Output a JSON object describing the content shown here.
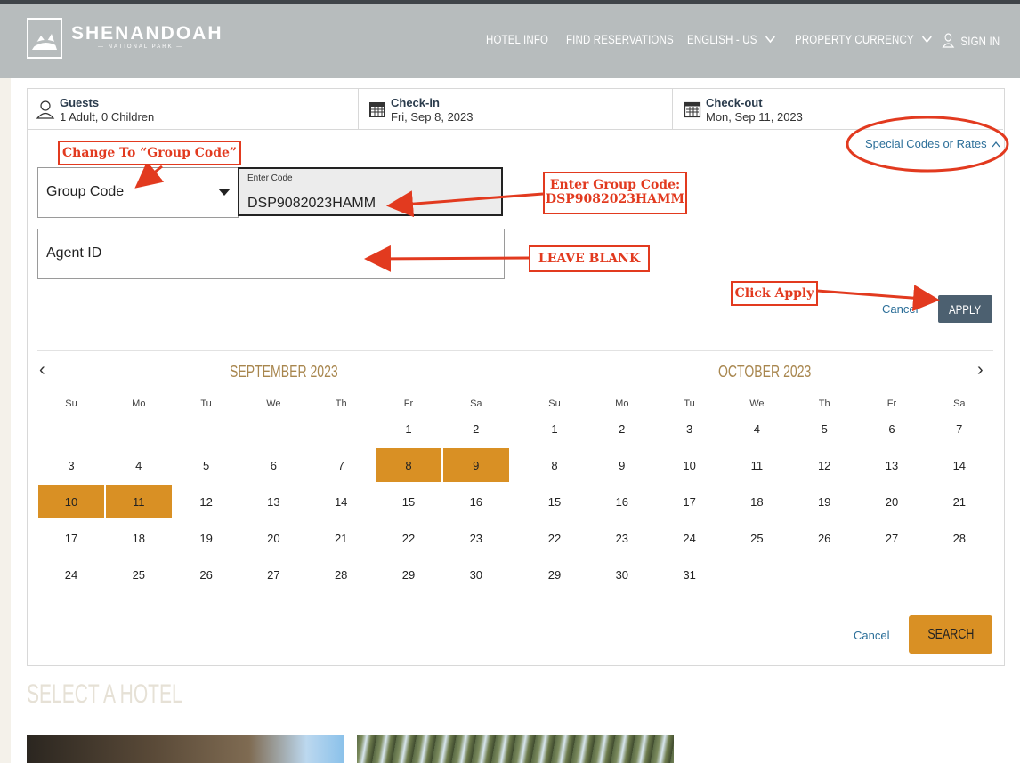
{
  "header": {
    "brand": "SHENANDOAH",
    "brand_sub": "— NATIONAL PARK —",
    "nav": {
      "hotel_info": "HOTEL INFO",
      "find_reservations": "FIND RESERVATIONS",
      "language": "ENGLISH - US",
      "currency": "PROPERTY CURRENCY",
      "sign_in": "SIGN IN"
    }
  },
  "booking_bar": {
    "guests": {
      "label": "Guests",
      "value": "1 Adult, 0 Children"
    },
    "checkin": {
      "label": "Check-in",
      "value": "Fri, Sep 8, 2023"
    },
    "checkout": {
      "label": "Check-out",
      "value": "Mon, Sep 11, 2023"
    }
  },
  "codes": {
    "special_link": "Special Codes or Rates",
    "code_type": "Group Code",
    "code_label": "Enter Code",
    "code_value": "DSP9082023HAMM",
    "agent_placeholder": "Agent ID",
    "cancel": "Cancel",
    "apply": "APPLY"
  },
  "annotations": {
    "change_to": "Change To “Group Code”",
    "enter_group_line1": "Enter Group Code:",
    "enter_group_line2": "DSP9082023HAMM",
    "leave_blank": "LEAVE BLANK",
    "click_apply": "Click Apply",
    "accent_color": "#e23a1f"
  },
  "calendar": {
    "weekdays": [
      "Su",
      "Mo",
      "Tu",
      "We",
      "Th",
      "Fr",
      "Sa"
    ],
    "left_month": {
      "title": "SEPTEMBER 2023",
      "weeks": [
        [
          "",
          "",
          "",
          "",
          "",
          "1",
          "2"
        ],
        [
          "3",
          "4",
          "5",
          "6",
          "7",
          "8",
          "9"
        ],
        [
          "10",
          "11",
          "12",
          "13",
          "14",
          "15",
          "16"
        ],
        [
          "17",
          "18",
          "19",
          "20",
          "21",
          "22",
          "23"
        ],
        [
          "24",
          "25",
          "26",
          "27",
          "28",
          "29",
          "30"
        ]
      ],
      "selected": [
        "8",
        "9",
        "10",
        "11"
      ]
    },
    "right_month": {
      "title": "OCTOBER 2023",
      "weeks": [
        [
          "1",
          "2",
          "3",
          "4",
          "5",
          "6",
          "7"
        ],
        [
          "8",
          "9",
          "10",
          "11",
          "12",
          "13",
          "14"
        ],
        [
          "15",
          "16",
          "17",
          "18",
          "19",
          "20",
          "21"
        ],
        [
          "22",
          "23",
          "24",
          "25",
          "26",
          "27",
          "28"
        ],
        [
          "29",
          "30",
          "31",
          "",
          "",
          "",
          ""
        ]
      ],
      "selected": []
    },
    "selected_color": "#d99024"
  },
  "footer": {
    "cancel": "Cancel",
    "search": "SEARCH"
  },
  "hotels": {
    "title": "SELECT A HOTEL"
  }
}
